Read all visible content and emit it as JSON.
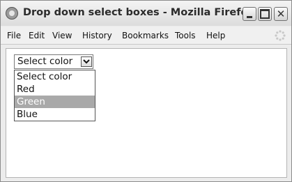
{
  "window": {
    "title": "Drop down select boxes - Mozilla Firefox"
  },
  "menubar": {
    "items": [
      "File",
      "Edit",
      "View",
      "History",
      "Bookmarks",
      "Tools",
      "Help"
    ]
  },
  "select": {
    "value": "Select color",
    "options": [
      "Select color",
      "Red",
      "Green",
      "Blue"
    ],
    "highlighted": "Green"
  },
  "icons": {
    "app": "firefox-icon",
    "minimize": "minimize-icon",
    "maximize": "maximize-icon",
    "close": "close-icon",
    "throbber": "throbber-icon",
    "dropdown": "chevron-down-icon"
  }
}
